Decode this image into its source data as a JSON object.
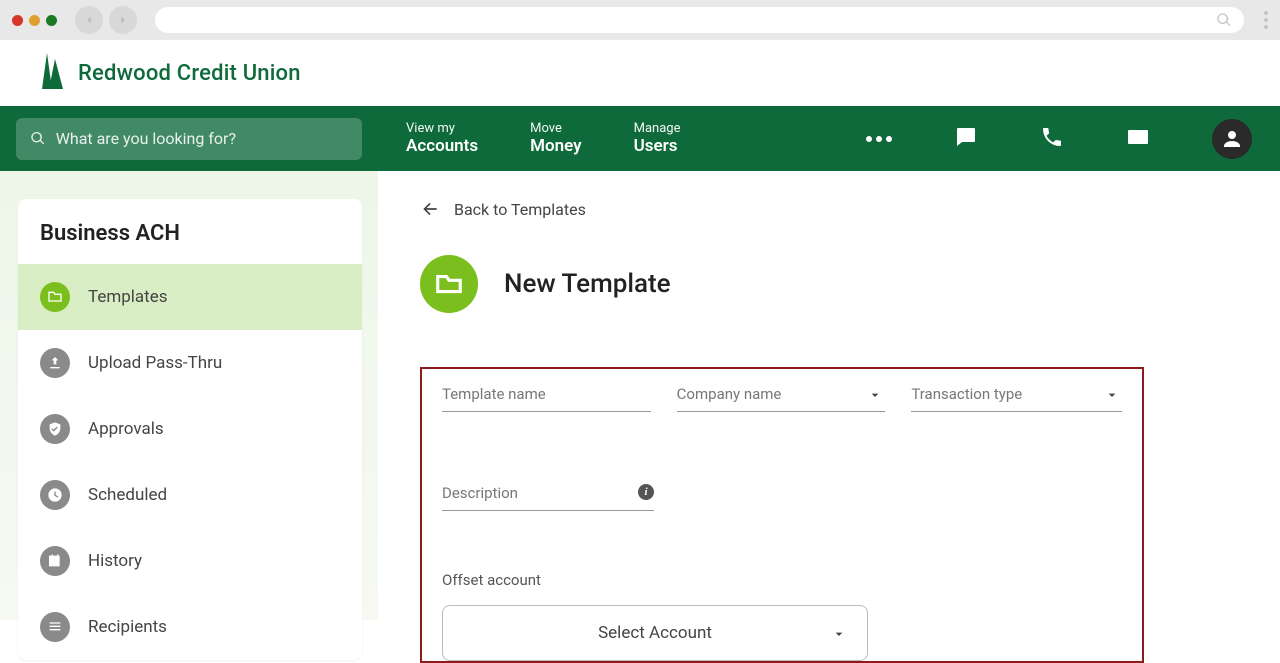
{
  "browser": {
    "url": ""
  },
  "brand": "Redwood Credit Union",
  "search": {
    "placeholder": "What are you looking for?"
  },
  "nav": {
    "accounts": {
      "small": "View my",
      "big": "Accounts"
    },
    "money": {
      "small": "Move",
      "big": "Money"
    },
    "users": {
      "small": "Manage",
      "big": "Users"
    }
  },
  "sidebar": {
    "title": "Business ACH",
    "items": [
      {
        "label": "Templates",
        "icon": "folder",
        "active": true
      },
      {
        "label": "Upload Pass-Thru",
        "icon": "upload",
        "active": false
      },
      {
        "label": "Approvals",
        "icon": "shield-check",
        "active": false
      },
      {
        "label": "Scheduled",
        "icon": "clock",
        "active": false
      },
      {
        "label": "History",
        "icon": "calendar",
        "active": false
      },
      {
        "label": "Recipients",
        "icon": "list",
        "active": false
      }
    ]
  },
  "main": {
    "back_label": "Back to Templates",
    "title": "New Template",
    "fields": {
      "template_name": "Template name",
      "company_name": "Company name",
      "transaction_type": "Transaction type",
      "description": "Description",
      "offset_account": "Offset account",
      "select_account": "Select Account"
    }
  }
}
